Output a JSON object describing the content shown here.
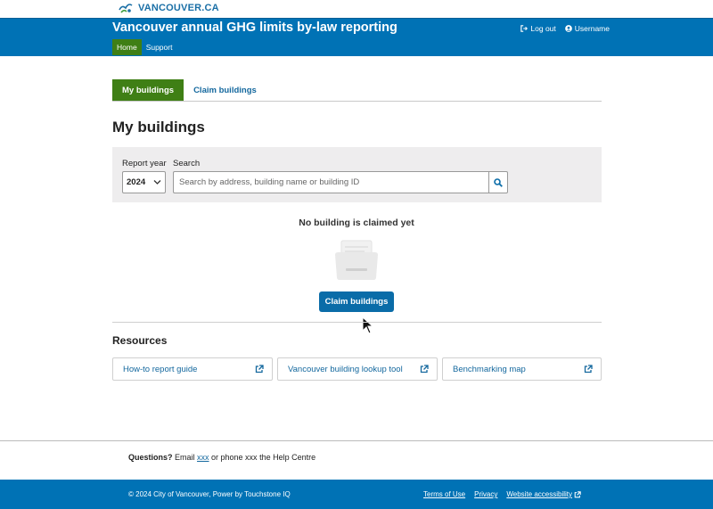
{
  "brand": {
    "name": "VANCOUVER.CA",
    "color": "#1a6fa6"
  },
  "header": {
    "title": "Vancouver annual GHG limits by-law reporting",
    "logout_label": "Log out",
    "username": "Username",
    "nav": [
      {
        "label": "Home",
        "active": true
      },
      {
        "label": "Support",
        "active": false
      }
    ],
    "bg_color": "#0072b5",
    "active_color": "#3f7f15"
  },
  "tabs": [
    {
      "label": "My buildings",
      "active": true
    },
    {
      "label": "Claim buildings",
      "active": false
    }
  ],
  "page_title": "My buildings",
  "search": {
    "year_label": "Report year",
    "year_value": "2024",
    "search_label": "Search",
    "placeholder": "Search by address, building name or building ID"
  },
  "empty_state": {
    "message": "No building is claimed yet",
    "button_label": "Claim buildings"
  },
  "resources": {
    "title": "Resources",
    "links": [
      {
        "label": "How-to report guide",
        "icon": "external-link-icon"
      },
      {
        "label": "Vancouver building lookup tool",
        "icon": "external-link-icon"
      },
      {
        "label": "Benchmarking map",
        "icon": "external-link-icon"
      }
    ]
  },
  "questions": {
    "prefix": "Questions?",
    "email_text": " Email ",
    "email_link": "xxx",
    "phone_text": " or phone xxx the Help Centre"
  },
  "footer": {
    "copyright": "© 2024 City of Vancouver, Power by Touchstone IQ",
    "links": [
      "Terms of Use",
      "Privacy",
      "Website accessibility"
    ]
  }
}
